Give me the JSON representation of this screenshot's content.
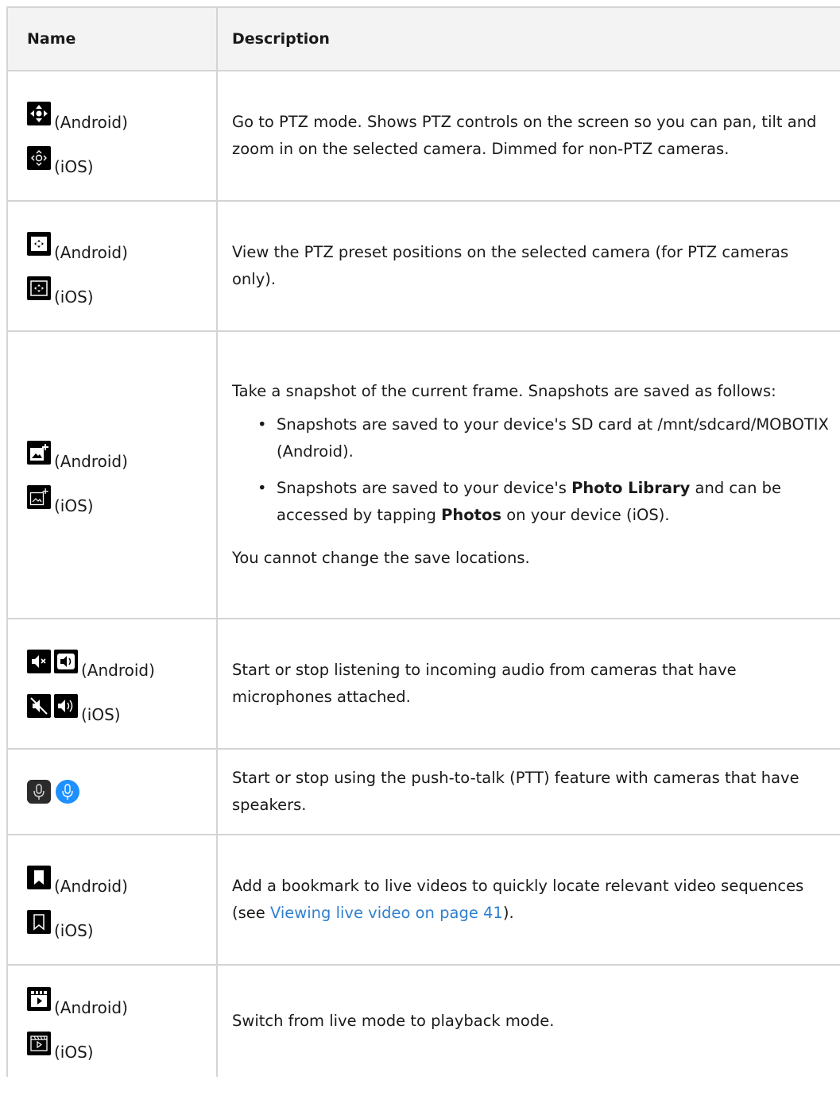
{
  "header": {
    "name": "Name",
    "description": "Description"
  },
  "rows": [
    {
      "android_label": "(Android)",
      "ios_label": "(iOS)",
      "android_icon": "ptz-move-icon",
      "ios_icon": "ptz-move-outline-icon",
      "description": "Go to PTZ mode. Shows PTZ controls on the screen so you can pan, tilt and zoom in on the selected camera. Dimmed for non-PTZ cameras."
    },
    {
      "android_label": "(Android)",
      "ios_label": "(iOS)",
      "android_icon": "ptz-preset-icon",
      "ios_icon": "ptz-preset-outline-icon",
      "description": "View the PTZ preset positions on the selected camera (for PTZ cameras only)."
    },
    {
      "android_label": "(Android)",
      "ios_label": "(iOS)",
      "android_icon": "snapshot-icon",
      "ios_icon": "snapshot-outline-icon",
      "description_intro": "Take a snapshot of the current frame. Snapshots are saved as follows:",
      "bullet1": "Snapshots are saved to your device's SD card at /mnt/sdcard/MOBOTIX (Android).",
      "bullet2_a": "Snapshots are saved to your device's ",
      "bullet2_b": "Photo Library",
      "bullet2_c": " and can be accessed by tapping ",
      "bullet2_d": "Photos",
      "bullet2_e": " on your device (iOS).",
      "description_outro": "You cannot change the save locations."
    },
    {
      "android_label": "(Android)",
      "ios_label": "(iOS)",
      "android_icons": [
        "speaker-mute-icon",
        "speaker-on-icon"
      ],
      "ios_icons": [
        "speaker-mute-icon",
        "speaker-on-icon"
      ],
      "description": "Start or stop listening to incoming audio from cameras that have microphones attached."
    },
    {
      "icons": [
        "microphone-icon",
        "microphone-active-icon"
      ],
      "description": "Start or stop using the push-to-talk (PTT) feature with cameras that have speakers."
    },
    {
      "android_label": "(Android)",
      "ios_label": "(iOS)",
      "android_icon": "bookmark-icon",
      "ios_icon": "bookmark-outline-icon",
      "description_a": "Add a bookmark to live videos to quickly locate relevant video sequences (see ",
      "link": "Viewing live video on page 41",
      "description_b": ")."
    },
    {
      "android_label": "(Android)",
      "ios_label": "(iOS)",
      "android_icon": "playback-icon",
      "ios_icon": "playback-outline-icon",
      "description": "Switch from live mode to playback mode."
    }
  ],
  "colors": {
    "link": "#2f7fd0",
    "border": "#d4d4d4",
    "header_bg": "#f3f3f3",
    "mic_active": "#1e90ff"
  }
}
